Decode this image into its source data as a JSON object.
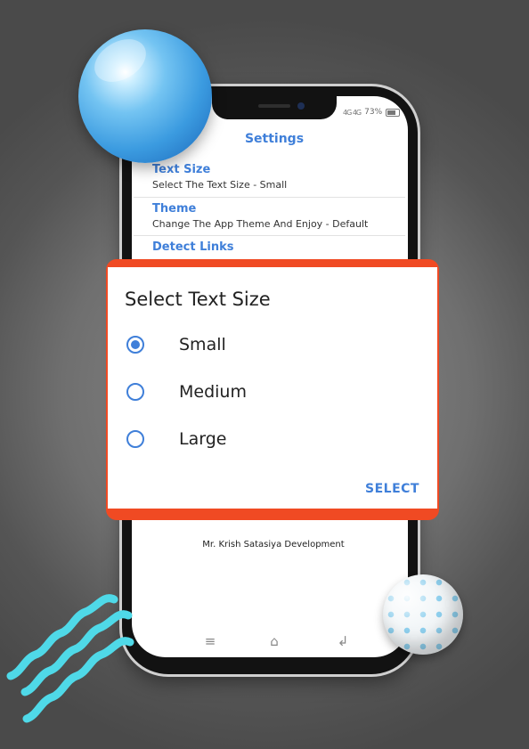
{
  "status_bar": {
    "signal": "4G 4G",
    "battery": "73%"
  },
  "settings": {
    "title": "Settings",
    "items": [
      {
        "title": "Text Size",
        "subtitle": "Select The Text Size - Small"
      },
      {
        "title": "Theme",
        "subtitle": "Change The App Theme And Enjoy - Default"
      },
      {
        "title": "Detect Links",
        "subtitle": ""
      }
    ],
    "credit": "Mr. Krish Satasiya Development"
  },
  "dialog": {
    "title": "Select Text Size",
    "options": [
      {
        "label": "Small",
        "checked": true
      },
      {
        "label": "Medium",
        "checked": false
      },
      {
        "label": "Large",
        "checked": false
      }
    ],
    "select_label": "SELECT"
  },
  "navbar": {
    "menu_icon": "≡",
    "home_icon": "⌂",
    "back_icon": "↲"
  },
  "colors": {
    "accent": "#3f7fd9",
    "dialog_border": "#f04a23",
    "squiggle": "#4fd9e8"
  }
}
